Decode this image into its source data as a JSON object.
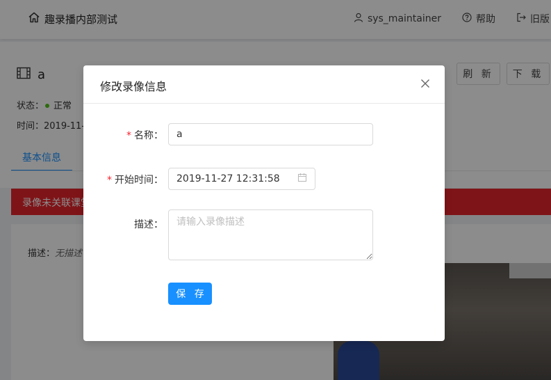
{
  "header": {
    "brand": "趣录播内部测试",
    "user": "sys_maintainer",
    "help": "帮助",
    "legacy": "旧版"
  },
  "page": {
    "recording_name": "a",
    "refresh_label": "刷 新",
    "download_label": "下 载",
    "status_label": "状态：",
    "status_value": "正常",
    "time_label": "时间：",
    "time_value": "2019-11-",
    "tab_basic": "基本信息",
    "alert_text": "录像未关联课堂",
    "desc_label": "描述：",
    "desc_value": "无描述"
  },
  "modal": {
    "title": "修改录像信息",
    "name_label": "名称：",
    "name_value": "a",
    "start_label": "开始时间：",
    "start_value": "2019-11-27 12:31:58",
    "desc_label": "描述：",
    "desc_placeholder": "请输入录像描述",
    "save_label": "保 存"
  },
  "colors": {
    "primary": "#1890ff",
    "required": "#f5222d",
    "alert": "#e8262d",
    "status_ok": "#52c41a"
  },
  "icons": [
    "home-icon",
    "user-icon",
    "help-icon",
    "logout-icon",
    "film-icon",
    "close-icon",
    "calendar-icon"
  ]
}
